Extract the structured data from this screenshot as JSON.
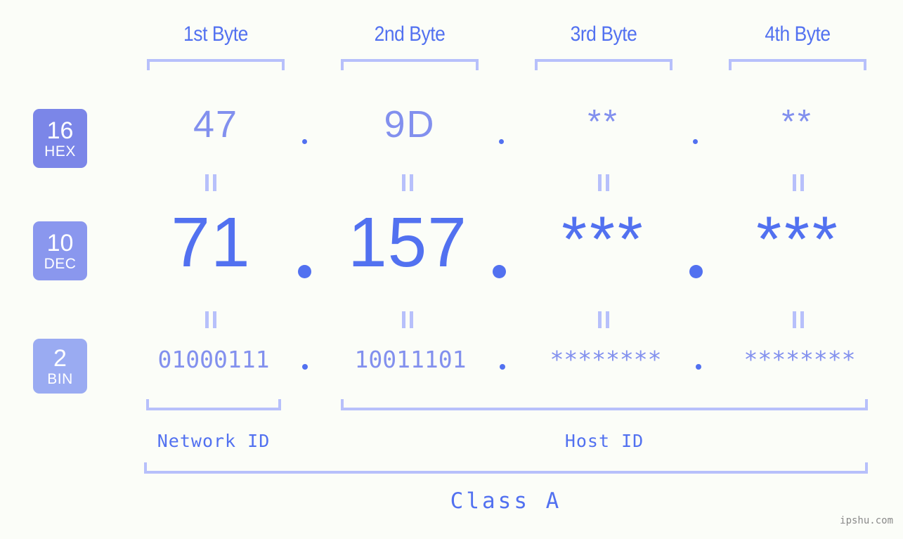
{
  "meta": {
    "background_color": "#fbfdf8",
    "accent_color": "#5271f0",
    "light_accent_color": "#8290ee",
    "bracket_color": "#b7c0fb"
  },
  "byte_headers": [
    {
      "label": "1st Byte"
    },
    {
      "label": "2nd Byte"
    },
    {
      "label": "3rd Byte"
    },
    {
      "label": "4th Byte"
    }
  ],
  "rows": [
    {
      "badge": {
        "number": "16",
        "word": "HEX",
        "color": "#7b86e8"
      },
      "values": [
        "47",
        "9D",
        "**",
        "**"
      ]
    },
    {
      "badge": {
        "number": "10",
        "word": "DEC",
        "color": "#8a97ee"
      },
      "values": [
        "71",
        "157",
        "***",
        "***"
      ]
    },
    {
      "badge": {
        "number": "2",
        "word": "BIN",
        "color": "#9aabf2"
      },
      "values": [
        "01000111",
        "10011101",
        "********",
        "********"
      ]
    }
  ],
  "separators": {
    "dot": "."
  },
  "segments": {
    "network_id": "Network ID",
    "host_id": "Host ID"
  },
  "class_label": "Class A",
  "watermark": "ipshu.com"
}
